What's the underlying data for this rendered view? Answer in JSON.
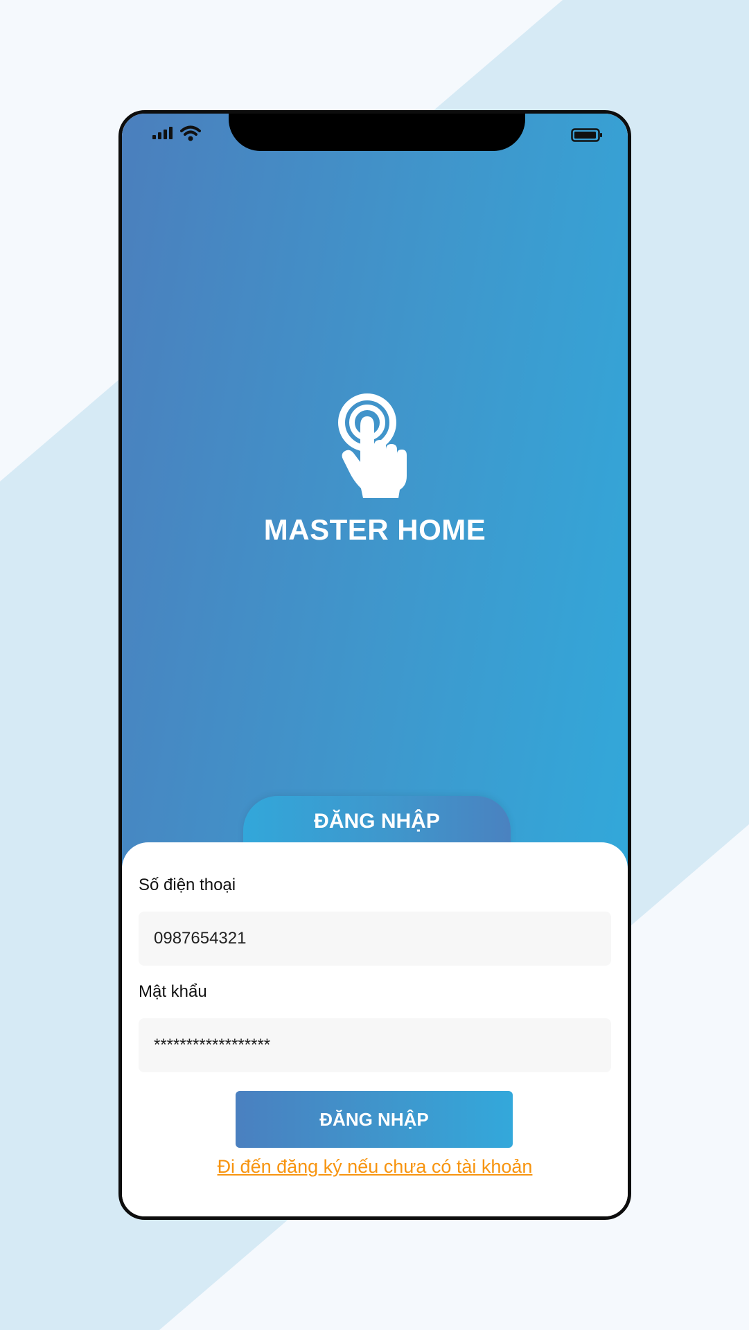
{
  "app": {
    "title": "MASTER HOME"
  },
  "icons": {
    "signal": "signal-bars-icon",
    "wifi": "wifi-icon",
    "battery": "battery-icon",
    "logo": "tap-hand-icon"
  },
  "tab": {
    "label": "ĐĂNG NHẬP"
  },
  "form": {
    "phone_label": "Số điện thoại",
    "phone_value": "0987654321",
    "password_label": "Mật khẩu",
    "password_value": "******************",
    "submit_label": "ĐĂNG NHẬP",
    "register_link": "Đi đến đăng ký nếu chưa có tài khoản"
  },
  "colors": {
    "gradient_start": "#4b7fbd",
    "gradient_end": "#32a8da",
    "link": "#f7940f",
    "background_stripe": "#d6eaf5"
  }
}
